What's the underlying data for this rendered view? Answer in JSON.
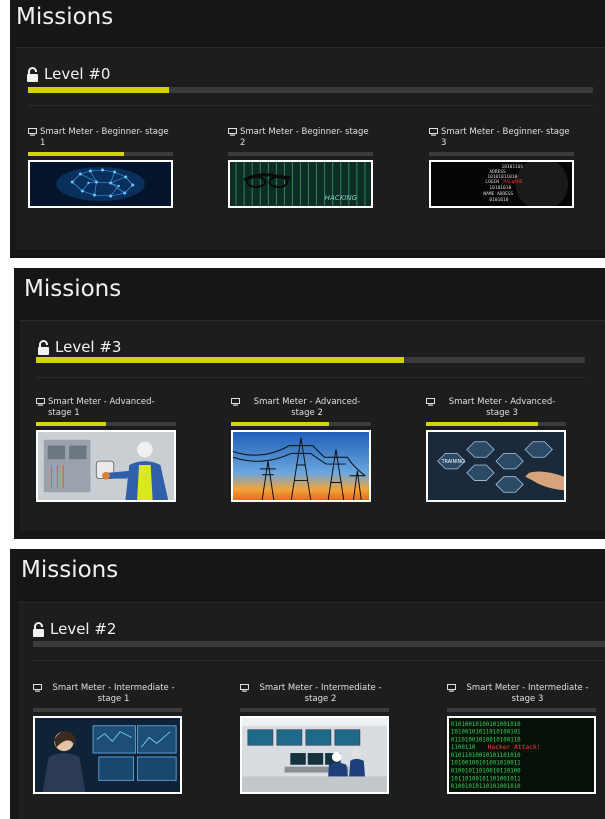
{
  "sections": [
    {
      "title": "Missions",
      "level_label": "Level #0",
      "level_progress": 0.25,
      "missions": [
        {
          "title": "Smart Meter - Beginner- stage 1",
          "progress": 0.66,
          "image": "brain-network"
        },
        {
          "title": "Smart Meter - Beginner- stage 2",
          "progress": 0.0,
          "image": "hacking-glasses"
        },
        {
          "title": "Smart Meter - Beginner- stage 3",
          "progress": 0.0,
          "image": "malware-code"
        }
      ]
    },
    {
      "title": "Missions",
      "level_label": "Level #3",
      "level_progress": 0.67,
      "missions": [
        {
          "title": "Smart Meter - Advanced-stage 1",
          "progress": 0.5,
          "image": "electrician-meter"
        },
        {
          "title": "Smart Meter - Advanced- stage 2",
          "progress": 0.7,
          "image": "power-lines"
        },
        {
          "title": "Smart Meter - Advanced- stage 3",
          "progress": 0.8,
          "image": "training-hexagons"
        }
      ]
    },
    {
      "title": "Missions",
      "level_label": "Level #2",
      "level_progress": 0.0,
      "missions": [
        {
          "title": "Smart Meter - Intermediate -stage 1",
          "progress": 0.0,
          "image": "control-room-woman"
        },
        {
          "title": "Smart Meter - Intermediate -stage 2",
          "progress": 0.0,
          "image": "control-room-operators"
        },
        {
          "title": "Smart Meter - Intermediate -stage 3",
          "progress": 0.0,
          "image": "hacker-attack-code"
        }
      ]
    }
  ],
  "thumbnail_texts": {
    "stage2_hacking": "HACKING",
    "stage3_malware": [
      "10101101",
      "ADRESS",
      "10101011010",
      "LOGIN",
      "MALWARE",
      "10101010",
      "NAME ADRESS",
      "0101010"
    ],
    "advanced_training": "TRAINING",
    "hacker_attack": "Hacker Attack!"
  },
  "colors": {
    "panel_bg": "#151617",
    "card_bg": "#1c1d1f",
    "track": "#3a3b3d",
    "accent": "#d4d400"
  }
}
